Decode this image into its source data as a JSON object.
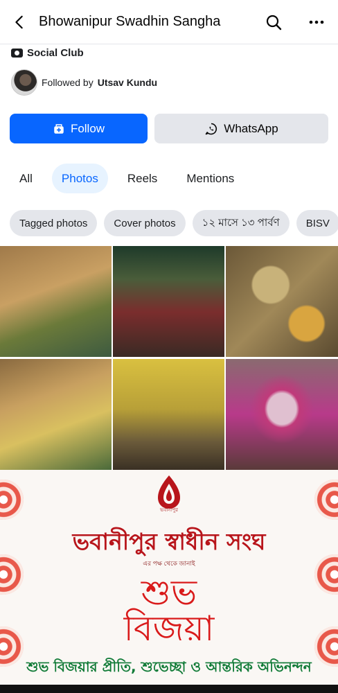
{
  "header": {
    "title": "Bhowanipur Swadhin Sangha"
  },
  "profile": {
    "category": "Social Club",
    "followed_prefix": "Followed by",
    "followed_name": "Utsav Kundu"
  },
  "actions": {
    "follow_label": "Follow",
    "whatsapp_label": "WhatsApp"
  },
  "tabs": [
    {
      "label": "All",
      "active": false
    },
    {
      "label": "Photos",
      "active": true
    },
    {
      "label": "Reels",
      "active": false
    },
    {
      "label": "Mentions",
      "active": false
    }
  ],
  "chips": [
    "Tagged photos",
    "Cover photos",
    "১২ মাসে ১৩ পার্বণ",
    "BISV"
  ],
  "photos": [
    "photo",
    "photo",
    "photo",
    "photo",
    "photo",
    "photo"
  ],
  "banner": {
    "logo_caption": "ভবানীপুর",
    "line1": "ভবানীপুর স্বাধীন সংঘ",
    "line2": "এর পক্ষ থেকে জানাই",
    "line3": "শুভ",
    "line4": "বিজয়া",
    "line5": "শুভ বিজয়ার প্রীতি, শুভেচ্ছা ও আন্তরিক অভিনন্দন"
  },
  "colors": {
    "accent": "#0866ff",
    "chip_bg": "#e4e6eb",
    "banner_red": "#d91a1a",
    "banner_green": "#0f7a36"
  }
}
